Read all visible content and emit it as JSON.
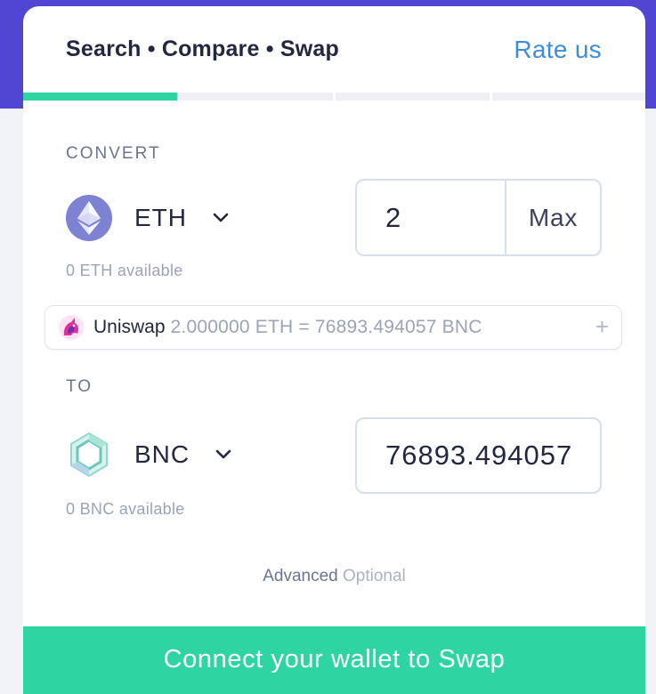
{
  "header": {
    "title": "Search • Compare • Swap",
    "rate_us": "Rate us"
  },
  "progress": {
    "steps": 4,
    "active_step": 1
  },
  "convert": {
    "label": "CONVERT",
    "token_symbol": "ETH",
    "token_icon": "ethereum-icon",
    "amount": "2",
    "max_label": "Max",
    "available": "0 ETH available"
  },
  "route": {
    "dex_icon": "uniswap-unicorn-icon",
    "dex_name": "Uniswap",
    "rate_text": "2.000000 ETH = 76893.494057 BNC",
    "expand": "+"
  },
  "to": {
    "label": "TO",
    "token_symbol": "BNC",
    "token_icon": "bifrost-hexagon-icon",
    "amount": "76893.494057",
    "available": "0 BNC available"
  },
  "advanced": {
    "label": "Advanced",
    "optional": "Optional"
  },
  "connect_button": "Connect your wallet to Swap",
  "colors": {
    "accent_green": "#2fd4a3",
    "brand_purple": "#5145d4",
    "link_blue": "#3d8ed6",
    "eth_icon": "#7d82d2"
  }
}
